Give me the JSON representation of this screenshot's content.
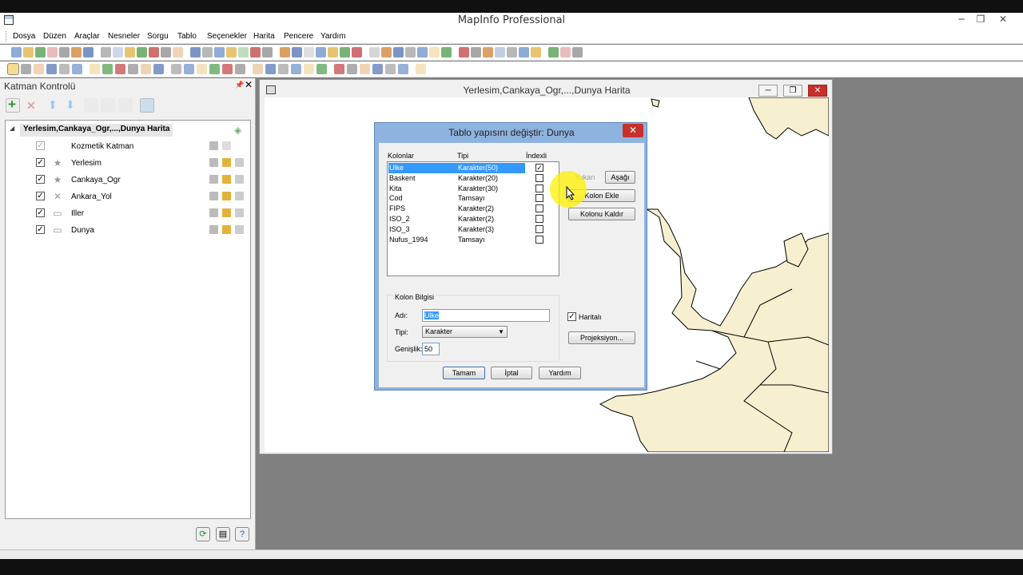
{
  "app": {
    "title": "MapInfo Professional",
    "minimize": "─",
    "maximize": "❐",
    "close": "✕"
  },
  "menu": [
    "Dosya",
    "Düzen",
    "Araçlar",
    "Nesneler",
    "Sorgu",
    "Tablo",
    "Seçenekler",
    "Harita",
    "Pencere",
    "Yardım"
  ],
  "layer_panel": {
    "title": "Katman Kontrolü",
    "root_label": "Yerlesim,Cankaya_Ogr,...,Dunya Harita",
    "layers": [
      {
        "name": "Kozmetik Katman",
        "checked": true,
        "gray": true,
        "icon": ""
      },
      {
        "name": "Yerlesim",
        "checked": true,
        "gray": false,
        "icon": "★"
      },
      {
        "name": "Cankaya_Ogr",
        "checked": true,
        "gray": false,
        "icon": "★"
      },
      {
        "name": "Ankara_Yol",
        "checked": true,
        "gray": false,
        "icon": "✕"
      },
      {
        "name": "Iller",
        "checked": true,
        "gray": false,
        "icon": "▭"
      },
      {
        "name": "Dunya",
        "checked": true,
        "gray": false,
        "icon": "▭"
      }
    ]
  },
  "map_window": {
    "title": "Yerlesim,Cankaya_Ogr,...,Dunya Harita",
    "land_color": "#f6efd0"
  },
  "dialog": {
    "title": "Tablo yapısını değiştir: Dunya",
    "close": "✕",
    "headers": {
      "columns": "Kolonlar",
      "type": "Tipi",
      "indexed": "İndexli"
    },
    "columns": [
      {
        "name": "Ulke",
        "type": "Karakter(50)",
        "indexed": true,
        "selected": true
      },
      {
        "name": "Baskent",
        "type": "Karakter(20)",
        "indexed": false,
        "selected": false
      },
      {
        "name": "Kita",
        "type": "Karakter(30)",
        "indexed": false,
        "selected": false
      },
      {
        "name": "Cod",
        "type": "Tamsayı",
        "indexed": false,
        "selected": false
      },
      {
        "name": "FIPS",
        "type": "Karakter(2)",
        "indexed": false,
        "selected": false
      },
      {
        "name": "ISO_2",
        "type": "Karakter(2)",
        "indexed": false,
        "selected": false
      },
      {
        "name": "ISO_3",
        "type": "Karakter(3)",
        "indexed": false,
        "selected": false
      },
      {
        "name": "Nufus_1994",
        "type": "Tamsayı",
        "indexed": false,
        "selected": false
      }
    ],
    "buttons": {
      "up": "Yukarı",
      "down": "Aşağı",
      "add_column": "Kolon Ekle",
      "remove_column": "Kolonu Kaldır",
      "projection": "Projeksiyon...",
      "ok": "Tamam",
      "cancel": "İptal",
      "help": "Yardım"
    },
    "mappable_label": "Haritalı",
    "mappable_checked": true,
    "column_info": {
      "title": "Kolon Bilgisi",
      "name_label": "Adı:",
      "name_value": "Ulke",
      "type_label": "Tipi:",
      "type_value": "Karakter",
      "width_label": "Genişlik:",
      "width_value": "50"
    }
  }
}
